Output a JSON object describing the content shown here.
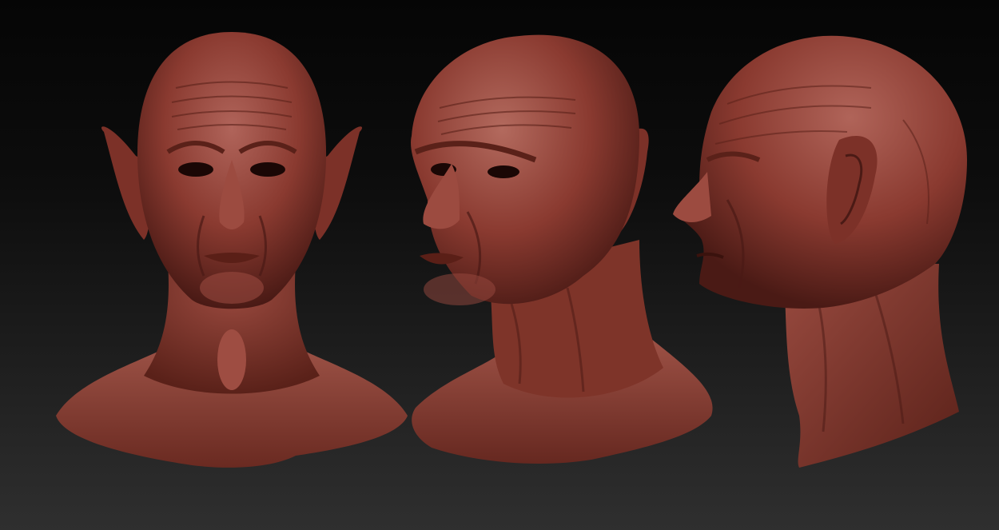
{
  "scene": {
    "subject": "",
    "background_top": "#050505",
    "background_bottom": "#2f2f2f",
    "material_color": "#8a3a30",
    "material_highlight": "#b5665a",
    "material_shadow": "#4a1a15"
  },
  "views": [
    {
      "id": "front",
      "label": ""
    },
    {
      "id": "three-quarter",
      "label": ""
    },
    {
      "id": "profile",
      "label": ""
    }
  ]
}
